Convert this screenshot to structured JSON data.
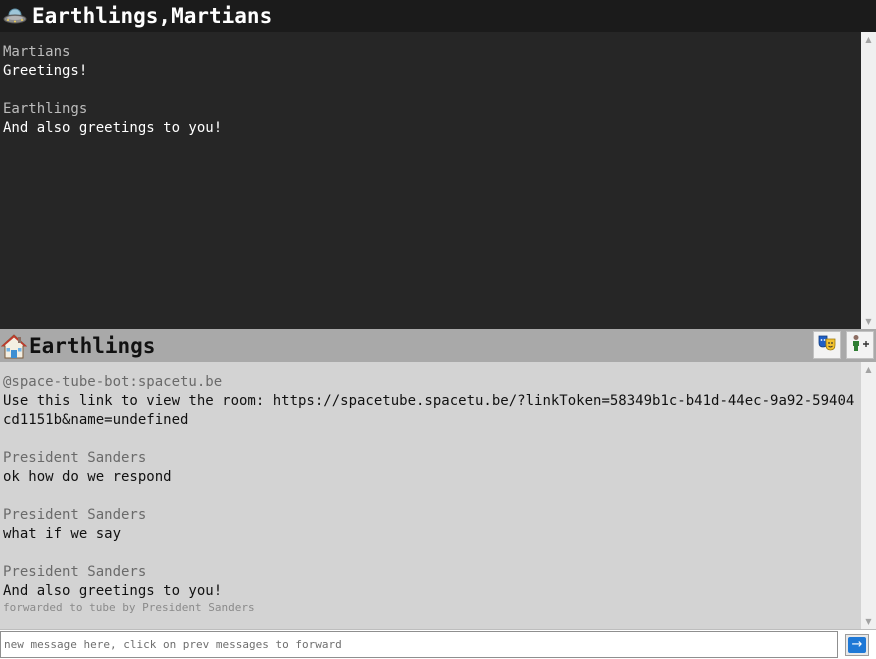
{
  "top_room": {
    "title": "Earthlings,Martians",
    "icon": "flying-saucer-icon",
    "messages": [
      {
        "sender": "Martians",
        "text": "Greetings!"
      },
      {
        "sender": "Earthlings",
        "text": "And also greetings to you!"
      }
    ]
  },
  "bottom_room": {
    "title": "Earthlings",
    "icon": "house-icon",
    "buttons": {
      "masks": "performing-arts-masks-icon",
      "add_person": "add-person-icon"
    },
    "messages": [
      {
        "sender": "@space-tube-bot:spacetu.be",
        "text": "Use this link to view the room: https://spacetube.spacetu.be/?linkToken=58349b1c-b41d-44ec-9a92-59404cd1151b&name=undefined"
      },
      {
        "sender": "President Sanders",
        "text": "ok how do we respond"
      },
      {
        "sender": "President Sanders",
        "text": "what if we say"
      },
      {
        "sender": "President Sanders",
        "text": "And also greetings to you!",
        "note": "forwarded to tube by President Sanders"
      }
    ]
  },
  "composer": {
    "placeholder": "new message here, click on prev messages to forward",
    "send_icon": "right-arrow-icon",
    "send_symbol": "→"
  },
  "colors": {
    "top_header_bg": "#1b1b1b",
    "top_pane_bg": "#262626",
    "mid_header_bg": "#a9a9a9",
    "bottom_pane_bg": "#d3d3d3",
    "send_button_blue": "#1e78d6"
  }
}
